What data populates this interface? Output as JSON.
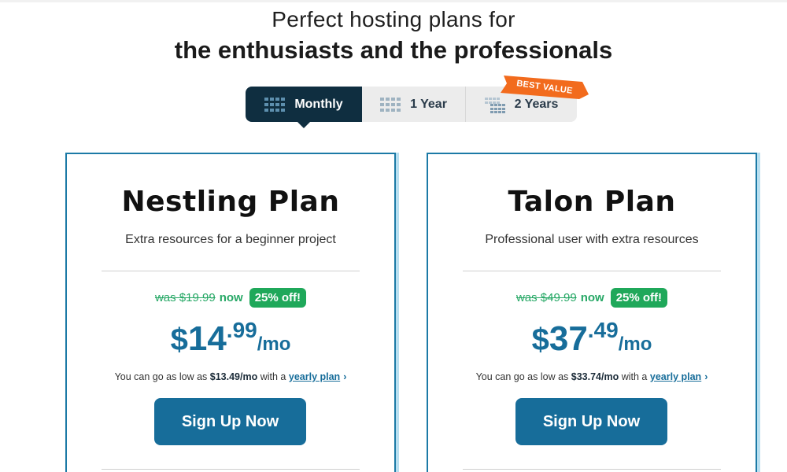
{
  "header": {
    "line1": "Perfect hosting plans for",
    "line2": "the enthusiasts and the professionals"
  },
  "terms": {
    "monthly": "Monthly",
    "one_year": "1 Year",
    "two_years": "2 Years",
    "selected": "Monthly",
    "badge": "BEST VALUE"
  },
  "colors": {
    "accent": "#176d9a",
    "dark_tab": "#0f2e40",
    "discount_green": "#1fa85a",
    "badge_orange": "#f26b1d"
  },
  "plans": [
    {
      "name": "Nestling Plan",
      "description": "Extra resources for a beginner project",
      "was_label": "was $19.99",
      "now_label": "now",
      "discount": "25% off!",
      "price_dollar": "$",
      "price_int": "14",
      "price_cents": ".99",
      "price_unit": "/mo",
      "lowest_prefix": "You can go as low as",
      "lowest_price": "$13.49/mo",
      "lowest_mid": "with a",
      "lowest_link": "yearly plan",
      "chevron": "›",
      "cta": "Sign Up Now"
    },
    {
      "name": "Talon Plan",
      "description": "Professional user with extra resources",
      "was_label": "was $49.99",
      "now_label": "now",
      "discount": "25% off!",
      "price_dollar": "$",
      "price_int": "37",
      "price_cents": ".49",
      "price_unit": "/mo",
      "lowest_prefix": "You can go as low as",
      "lowest_price": "$33.74/mo",
      "lowest_mid": "with a",
      "lowest_link": "yearly plan",
      "chevron": "›",
      "cta": "Sign Up Now"
    }
  ]
}
